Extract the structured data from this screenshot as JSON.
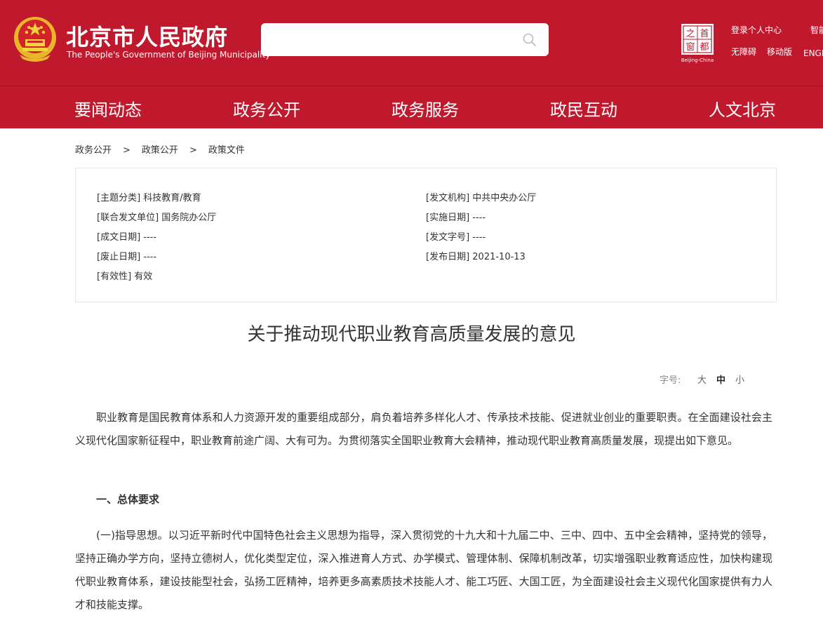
{
  "header": {
    "site_title_cn": "北京市人民政府",
    "site_title_en": "The People's Government of Beijing Municipality",
    "search": {
      "placeholder": ""
    },
    "capital_logo": {
      "text": "首都之窗",
      "sub": "Beijing-China"
    },
    "links": {
      "login": "登录个人中心",
      "smart": "智能",
      "accessibility": "无障碍",
      "mobile": "移动版",
      "english": "ENGL"
    },
    "brand_color": "#c0182c"
  },
  "nav": {
    "items": [
      "要闻动态",
      "政务公开",
      "政务服务",
      "政民互动",
      "人文北京"
    ]
  },
  "breadcrumb": {
    "items": [
      "政务公开",
      "政策公开",
      "政策文件"
    ],
    "separator": ">"
  },
  "info": {
    "topic": "[主题分类] 科技教育/教育",
    "issuer": "[发文机构] 中共中央办公厅",
    "joint_issuer": "[联合发文单位] 国务院办公厅",
    "effective_date": "[实施日期] ----",
    "written_date": "[成文日期] ----",
    "doc_number": "[发文字号] ----",
    "abolish_date": "[废止日期] ----",
    "publish_date": "[发布日期] 2021-10-13",
    "validity": "[有效性] 有效"
  },
  "article": {
    "title": "关于推动现代职业教育高质量发展的意见",
    "font_size": {
      "label": "字号:",
      "large": "大",
      "medium": "中",
      "small": "小"
    },
    "para1": "职业教育是国民教育体系和人力资源开发的重要组成部分，肩负着培养多样化人才、传承技术技能、促进就业创业的重要职责。在全面建设社会主义现代化国家新征程中，职业教育前途广阔、大有可为。为贯彻落实全国职业教育大会精神，推动现代职业教育高质量发展，现提出如下意见。",
    "section1": "一、总体要求",
    "para2": "(一)指导思想。以习近平新时代中国特色社会主义思想为指导，深入贯彻党的十九大和十九届二中、三中、四中、五中全会精神，坚持党的领导，坚持正确办学方向，坚持立德树人，优化类型定位，深入推进育人方式、办学模式、管理体制、保障机制改革，切实增强职业教育适应性，加快构建现代职业教育体系，建设技能型社会，弘扬工匠精神，培养更多高素质技术技能人才、能工巧匠、大国工匠，为全面建设社会主义现代化国家提供有力人才和技能支撑。"
  }
}
